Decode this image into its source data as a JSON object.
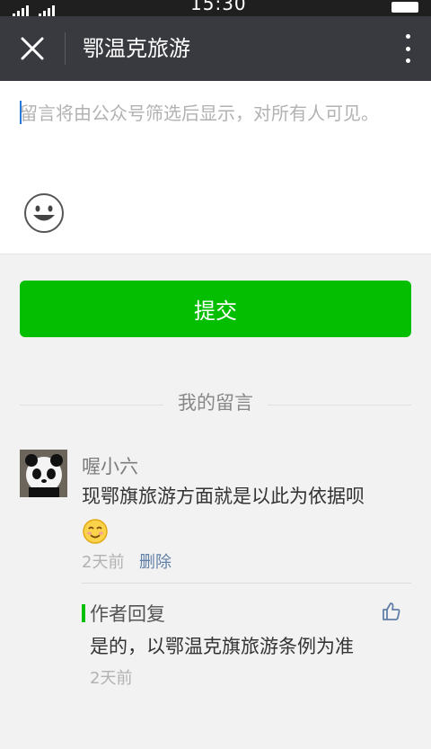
{
  "status_bar": {
    "time": "15:30"
  },
  "nav": {
    "title": "鄂温克旅游"
  },
  "editor": {
    "placeholder": "留言将由公众号筛选后显示，对所有人可见。"
  },
  "submit": {
    "label": "提交"
  },
  "my_comments": {
    "title": "我的留言"
  },
  "comment": {
    "nickname": "喔小六",
    "content": "现鄂旗旅游方面就是以此为依据呗",
    "time": "2天前",
    "delete_label": "删除",
    "reply": {
      "label": "作者回复",
      "content": "是的，以鄂温克旗旅游条例为准",
      "time": "2天前"
    }
  },
  "icons": {
    "close": "close-icon",
    "more": "more-icon",
    "emoji": "emoji-icon",
    "smile": "smile-emoji-icon",
    "thumb": "thumb-up-icon"
  },
  "colors": {
    "accent": "#04be02",
    "navbar": "#393a3f",
    "link": "#607fa6"
  }
}
